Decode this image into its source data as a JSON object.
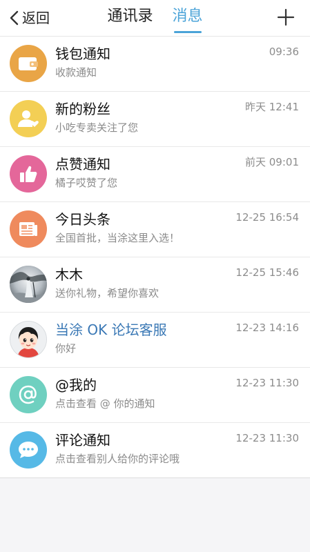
{
  "header": {
    "back_label": "返回",
    "tabs": [
      {
        "label": "通讯录",
        "active": false
      },
      {
        "label": "消息",
        "active": true
      }
    ],
    "accent_color": "#4aa3d8"
  },
  "messages": [
    {
      "title": "钱包通知",
      "subtitle": "收款通知",
      "time": "09:36",
      "icon": "wallet-icon",
      "color": "#e9a546"
    },
    {
      "title": "新的粉丝",
      "subtitle": "小吃专卖关注了您",
      "time": "昨天 12:41",
      "icon": "person-heart-icon",
      "color": "#f3cf55"
    },
    {
      "title": "点赞通知",
      "subtitle": "橘子哎赞了您",
      "time": "前天 09:01",
      "icon": "thumbs-up-icon",
      "color": "#e4679a"
    },
    {
      "title": "今日头条",
      "subtitle": "全国首批，当涂这里入选！",
      "time": "12-25 16:54",
      "icon": "newspaper-icon",
      "color": "#ef8a5d"
    },
    {
      "title": "木木",
      "subtitle": "送你礼物，希望你喜欢",
      "time": "12-25 15:46",
      "icon": "painting-avatar",
      "color": "#cfd4d8"
    },
    {
      "title": "当涂 OK 论坛客服",
      "subtitle": "你好",
      "time": "12-23 14:16",
      "icon": "girl-avatar",
      "color": "#e9ecef"
    },
    {
      "title": "@我的",
      "subtitle": "点击查看 @ 你的通知",
      "time": "12-23 11:30",
      "icon": "at-icon",
      "color": "#6fd0c0"
    },
    {
      "title": "评论通知",
      "subtitle": "点击查看别人给你的评论哦",
      "time": "12-23 11:30",
      "icon": "chat-bubble-icon",
      "color": "#56b9e6"
    }
  ]
}
